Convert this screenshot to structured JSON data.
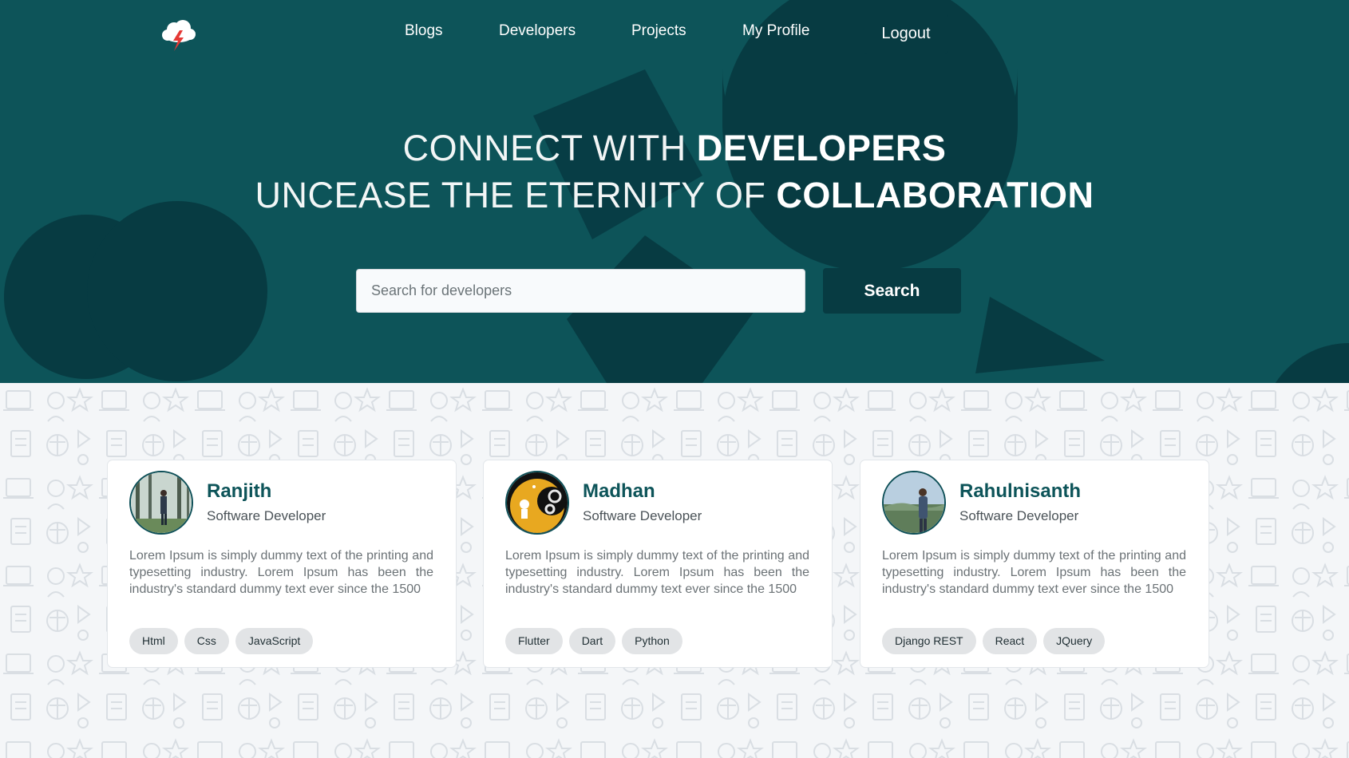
{
  "nav": {
    "logo_icon": "storm-cloud-logo-icon",
    "links": [
      "Blogs",
      "Developers",
      "Projects",
      "My Profile"
    ],
    "logout_label": "Logout"
  },
  "hero": {
    "line1_light": "CONNECT WITH ",
    "line1_bold": "DEVELOPERS",
    "line2_light": "UNCEASE THE ETERNITY OF ",
    "line2_bold": "COLLABORATION",
    "search_placeholder": "Search for developers",
    "search_value": "",
    "search_button": "Search"
  },
  "developers": [
    {
      "name": "Ranjith",
      "role": "Software Developer",
      "bio": "Lorem Ipsum is simply dummy text of the printing and typesetting industry. Lorem Ipsum has been the industry's standard dummy text ever since the 1500",
      "tags": [
        "Html",
        "Css",
        "JavaScript"
      ]
    },
    {
      "name": "Madhan",
      "role": "Software Developer",
      "bio": "Lorem Ipsum is simply dummy text of the printing and typesetting industry. Lorem Ipsum has been the industry's standard dummy text ever since the 1500",
      "tags": [
        "Flutter",
        "Dart",
        "Python"
      ]
    },
    {
      "name": "Rahulnisanth",
      "role": "Software Developer",
      "bio": "Lorem Ipsum is simply dummy text of the printing and typesetting industry. Lorem Ipsum has been the industry's standard dummy text ever since the 1500",
      "tags": [
        "Django REST",
        "React",
        "JQuery"
      ]
    }
  ],
  "colors": {
    "hero_bg": "#0d5459",
    "hero_shape": "#073b42",
    "accent_dark": "#073b42",
    "name_color": "#0d5459",
    "tag_bg": "#e2e4e6"
  }
}
